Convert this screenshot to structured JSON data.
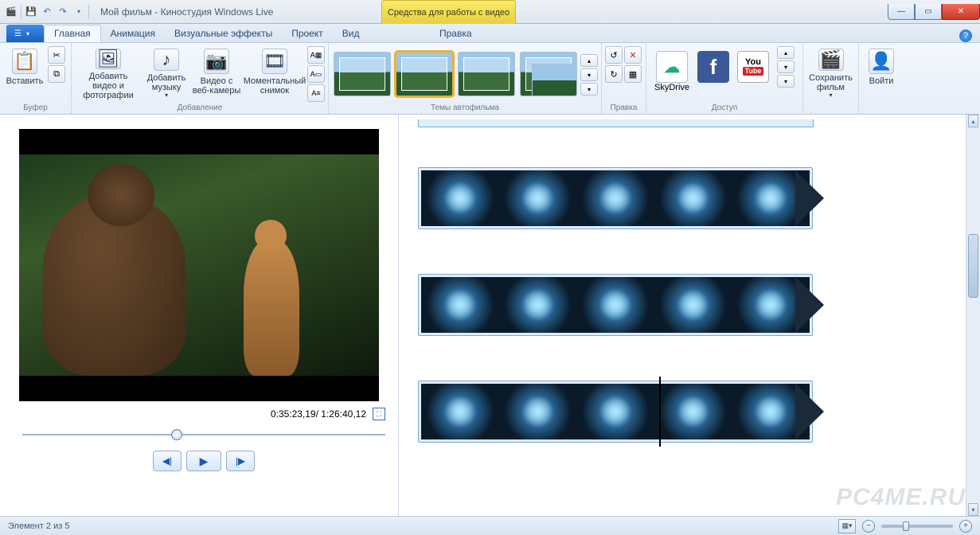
{
  "titlebar": {
    "title": "Мой фильм - Киностудия Windows Live",
    "contextual": "Средства для работы с видео"
  },
  "tabs": {
    "file": "",
    "home": "Главная",
    "animation": "Анимация",
    "effects": "Визуальные эффекты",
    "project": "Проект",
    "view": "Вид",
    "edit": "Правка"
  },
  "ribbon": {
    "buffer": {
      "paste": "Вставить",
      "group": "Буфер"
    },
    "add": {
      "video_photo": "Добавить видео и фотографии",
      "music": "Добавить музыку",
      "webcam": "Видео с веб-камеры",
      "snapshot": "Моментальный снимок",
      "group": "Добавление"
    },
    "themes": {
      "group": "Темы автофильма"
    },
    "edit": {
      "group": "Правка"
    },
    "share": {
      "skydrive": "SkyDrive",
      "youtube_top": "You",
      "youtube_bottom": "Tube",
      "group": "Доступ"
    },
    "save": {
      "label": "Сохранить фильм"
    },
    "login": {
      "label": "Войти"
    }
  },
  "preview": {
    "time": "0:35:23,19/ 1:26:40,12"
  },
  "status": {
    "item": "Элемент 2 из 5"
  },
  "watermark": "PC4ME.RU"
}
